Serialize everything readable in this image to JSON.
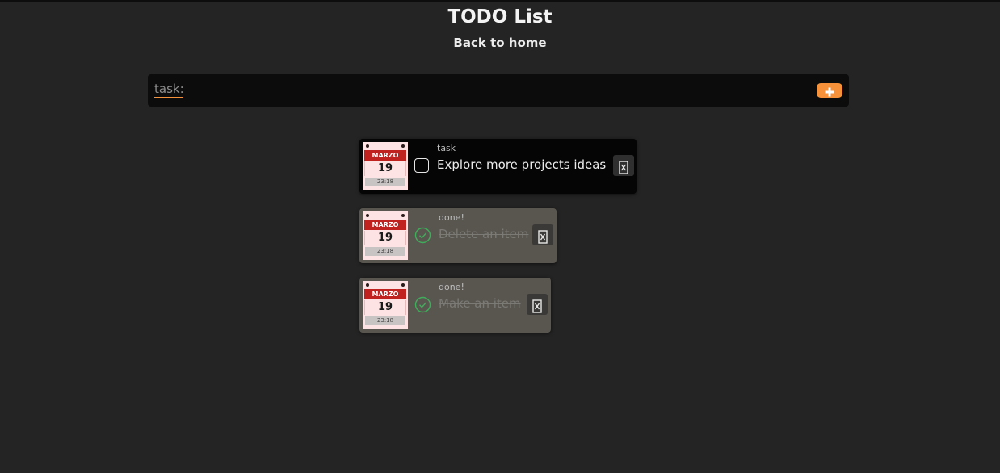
{
  "header": {
    "title": "TODO List",
    "home_link": "Back to home"
  },
  "task_form": {
    "placeholder": "task:",
    "value": "",
    "add_icon": "plus-icon"
  },
  "todos": [
    {
      "status": "task",
      "text": "Explore more projects ideas",
      "done": false,
      "calendar": {
        "month": "MARZO",
        "day": "19",
        "time": "23:18"
      }
    },
    {
      "status": "done!",
      "text": "Delete an item",
      "done": true,
      "calendar": {
        "month": "MARZO",
        "day": "19",
        "time": "23:18"
      }
    },
    {
      "status": "done!",
      "text": "Make an item",
      "done": true,
      "calendar": {
        "month": "MARZO",
        "day": "19",
        "time": "23:18"
      }
    }
  ],
  "colors": {
    "background": "#242424",
    "accent": "#f7923a",
    "calendar_red": "#c0221f",
    "done_card": "#595650",
    "check_green": "#3fae5a"
  }
}
